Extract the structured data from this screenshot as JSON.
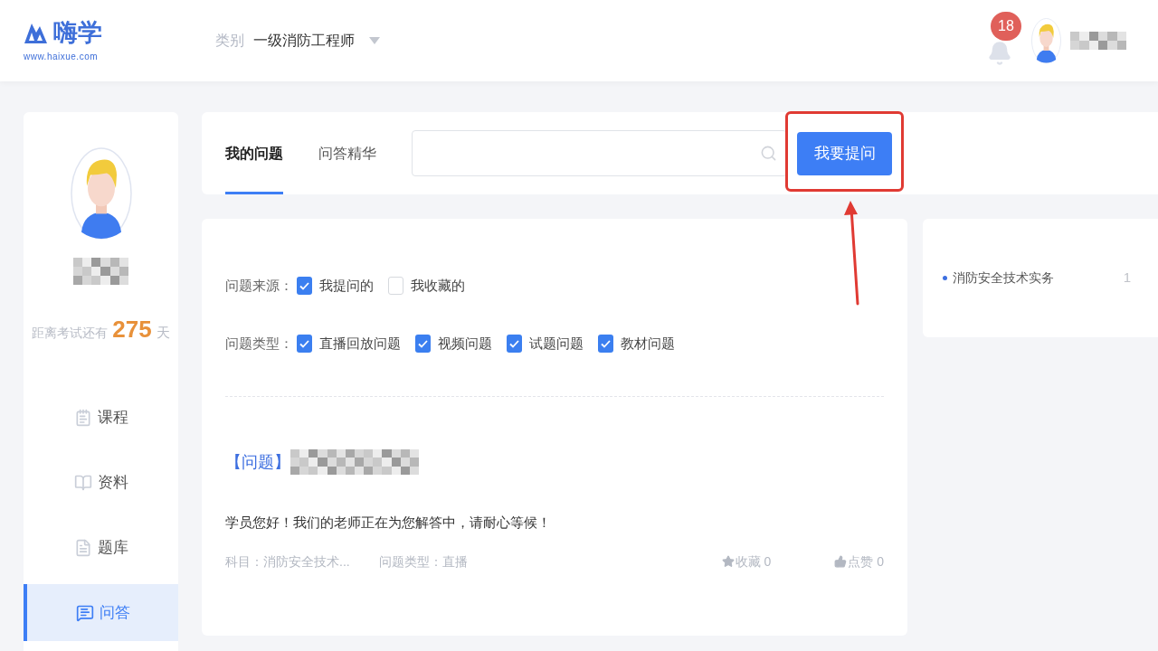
{
  "header": {
    "logo": {
      "name": "嗨学",
      "url": "www.haixue.com"
    },
    "category": {
      "label": "类别",
      "value": "一级消防工程师"
    },
    "notifications": {
      "count": "18"
    }
  },
  "sidebar": {
    "countdown": {
      "prefix": "距离考试还有",
      "days": "275",
      "suffix": "天"
    },
    "items": [
      {
        "label": "课程",
        "selected": false
      },
      {
        "label": "资料",
        "selected": false
      },
      {
        "label": "题库",
        "selected": false
      },
      {
        "label": "问答",
        "selected": true
      }
    ]
  },
  "tabs": [
    {
      "label": "我的问题",
      "selected": true
    },
    {
      "label": "问答精华",
      "selected": false
    }
  ],
  "ask_button": "我要提问",
  "filters": [
    {
      "label": "问题来源：",
      "options": [
        {
          "label": "我提问的",
          "checked": true
        },
        {
          "label": "我收藏的",
          "checked": false
        }
      ]
    },
    {
      "label": "问题类型：",
      "options": [
        {
          "label": "直播回放问题",
          "checked": true
        },
        {
          "label": "视频问题",
          "checked": true
        },
        {
          "label": "试题问题",
          "checked": true
        },
        {
          "label": "教材问题",
          "checked": true
        }
      ]
    }
  ],
  "questions": [
    {
      "tag": "【问题】",
      "answer": "学员您好！我们的老师正在为您解答中，请耐心等候！",
      "subject": "科目：消防安全技术...",
      "type": "问题类型：直播",
      "favorites": "收藏 0",
      "likes": "点赞 0"
    }
  ],
  "subjects": [
    {
      "name": "消防安全技术实务",
      "count": "1"
    }
  ]
}
